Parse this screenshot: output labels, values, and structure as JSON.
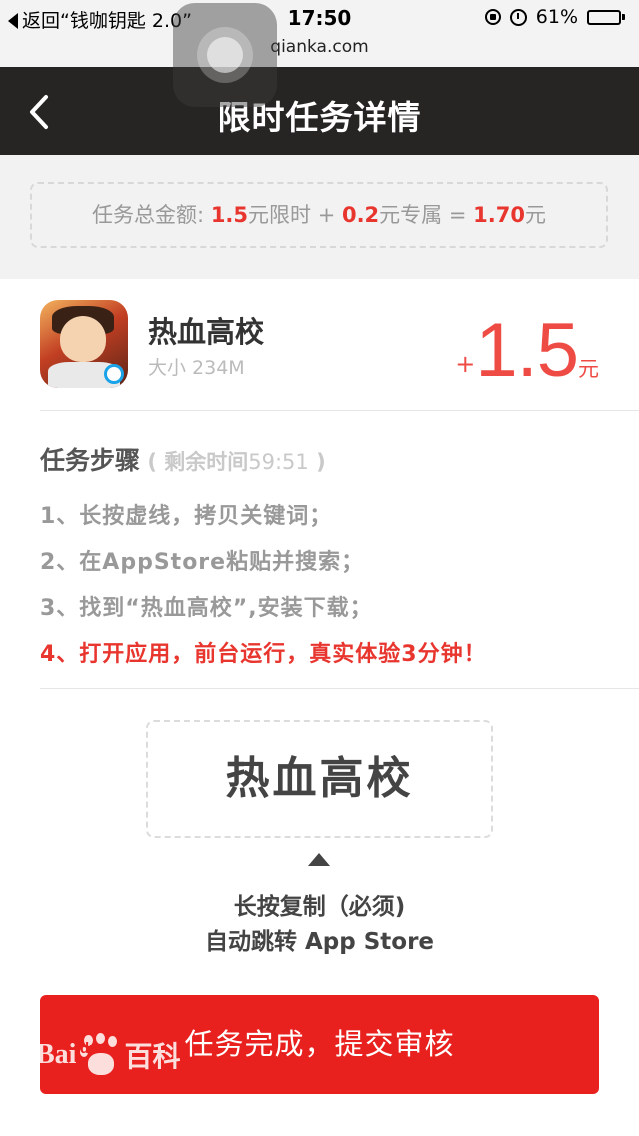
{
  "status_bar": {
    "back_label": "返回“钱咖钥匙 2.0”",
    "time": "17:50",
    "url": "qianka.com",
    "battery": "61%",
    "battery_level": 0.61
  },
  "nav": {
    "title": "限时任务详情",
    "back_icon": "chevron-left-icon"
  },
  "amount": {
    "prefix": "任务总金额: ",
    "limited_value": "1.5",
    "limited_label": "元限时 + ",
    "exclusive_value": "0.2",
    "exclusive_label": "元专属 = ",
    "total_value": "1.70",
    "total_unit": "元"
  },
  "app": {
    "name": "热血高校",
    "size": "大小 234M",
    "price_plus": "+",
    "price": "1.5",
    "price_unit": "元"
  },
  "steps": {
    "title": "任务步骤",
    "remain_open": " ( 剩余时间",
    "countdown": "59:51",
    "remain_close": " )",
    "items": [
      "1、长按虚线，拷贝关键词；",
      "2、在AppStore粘贴并搜索；",
      "3、找到“热血高校”,安装下载；",
      "4、打开应用，前台运行，真实体验3分钟！"
    ]
  },
  "keyword": {
    "text": "热血高校",
    "hint_line1": "长按复制（必须)",
    "hint_line2": "自动跳转 App Store"
  },
  "submit": {
    "label": "任务完成，提交审核"
  },
  "watermark": {
    "left": "Bai",
    "middle": "du",
    "right": "百科"
  },
  "colors": {
    "accent_red": "#e8211f",
    "nav_bg": "#272524",
    "price_red": "#ef4b45"
  }
}
